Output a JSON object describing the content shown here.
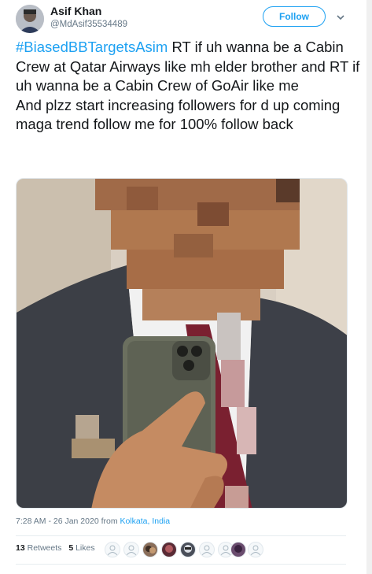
{
  "author": {
    "display_name": "Asif Khan",
    "handle": "@MdAsif35534489"
  },
  "follow_button": {
    "label": "Follow"
  },
  "tweet": {
    "hashtag": "#BiasedBBTargetsAsim",
    "text": " RT if uh wanna be a Cabin Crew at Qatar Airways like mh elder brother and RT if uh wanna be a Cabin Crew of GoAir like me",
    "text_line2": "And plzz start increasing followers for d up coming maga trend follow me for 100% follow back"
  },
  "meta": {
    "time": "7:28 AM - 26 Jan 2020",
    "from_word": "from",
    "location": "Kolkata, India"
  },
  "stats": {
    "retweets_count": "13",
    "retweets_label": "Retweets",
    "likes_count": "5",
    "likes_label": "Likes"
  },
  "colors": {
    "accent": "#1da1f2",
    "text": "#14171a",
    "muted": "#657786"
  },
  "icons": {
    "caret": "chevron-down-icon",
    "liker_default": "default-avatar-icon"
  }
}
